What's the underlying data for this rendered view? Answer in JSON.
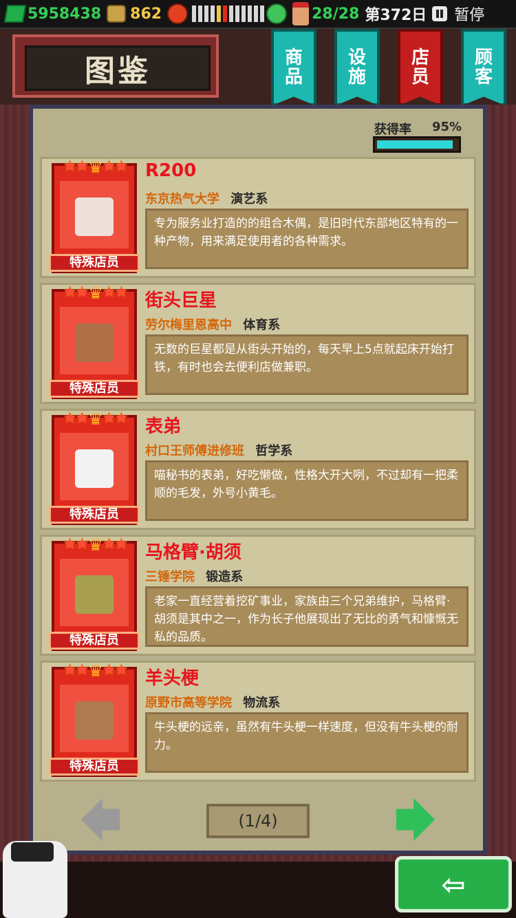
{
  "status": {
    "money": "5958438",
    "coins": "862",
    "staff": "28/28",
    "day": "第372日",
    "pause_label": "暂停"
  },
  "header": {
    "title": "图鉴",
    "tabs": [
      {
        "label_top": "商",
        "label_bottom": "品",
        "active": false
      },
      {
        "label_top": "设",
        "label_bottom": "施",
        "active": false
      },
      {
        "label_top": "店",
        "label_bottom": "员",
        "active": true
      },
      {
        "label_top": "顾",
        "label_bottom": "客",
        "active": false
      }
    ]
  },
  "collection": {
    "rate_label": "获得率",
    "rate_value": "95%",
    "rate_fraction": 0.95
  },
  "cards": [
    {
      "name": "R200",
      "school": "东京热气大学",
      "dept": "演艺系",
      "tag": "特殊店员",
      "desc": "专为服务业打造的的组合木偶，是旧时代东部地区特有的一种产物，用来满足使用者的各种需求。",
      "face_color": "#f0e0dc"
    },
    {
      "name": "街头巨星",
      "school": "劳尔梅里恩高中",
      "dept": "体育系",
      "tag": "特殊店员",
      "desc": "无数的巨星都是从街头开始的，每天早上5点就起床开始打铁，有时也会去便利店做兼职。",
      "face_color": "#b07048"
    },
    {
      "name": "表弟",
      "school": "村口王师傅进修班",
      "dept": "哲学系",
      "tag": "特殊店员",
      "desc": "喵秘书的表弟，好吃懒做，性格大开大咧，不过却有一把柔顺的毛发，外号小黄毛。",
      "face_color": "#f2f2f2"
    },
    {
      "name": "马格臂·胡须",
      "school": "三锤学院",
      "dept": "锻造系",
      "tag": "特殊店员",
      "desc": "老家一直经营着挖矿事业，家族由三个兄弟维护，马格臂·胡须是其中之一，作为长子他展现出了无比的勇气和慷慨无私的品质。",
      "face_color": "#a8a050"
    },
    {
      "name": "羊头梗",
      "school": "原野市高等学院",
      "dept": "物流系",
      "tag": "特殊店员",
      "desc": "牛头梗的远亲，虽然有牛头梗一样速度，但没有牛头梗的耐力。",
      "face_color": "#b07a50"
    }
  ],
  "pager": {
    "text": "(1/4)"
  },
  "colors": {
    "accent_red": "#e8141e",
    "school_orange": "#d4660a",
    "teal_tab": "#1db8b0",
    "panel": "#b7b08c"
  }
}
